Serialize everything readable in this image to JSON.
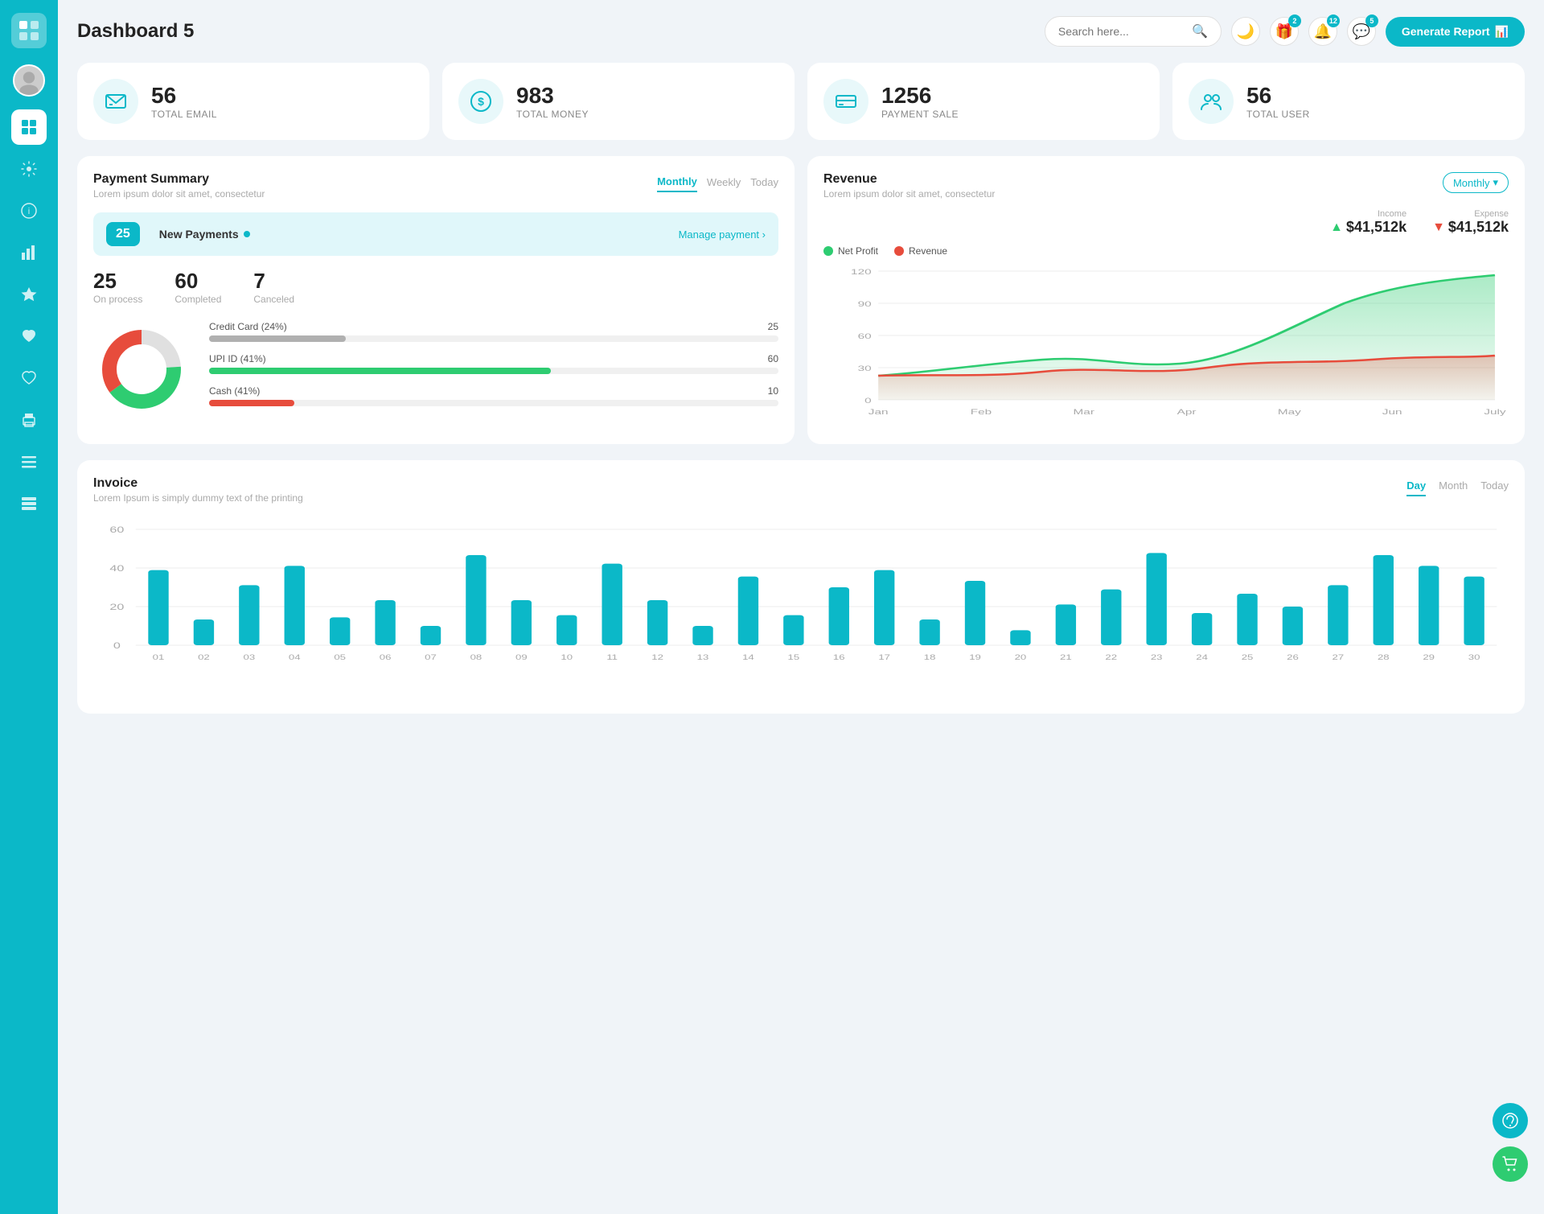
{
  "app": {
    "title": "Dashboard 5"
  },
  "header": {
    "search_placeholder": "Search here...",
    "generate_btn": "Generate Report",
    "badge_gifts": "2",
    "badge_bell": "12",
    "badge_chat": "5"
  },
  "stats": [
    {
      "id": "email",
      "number": "56",
      "label": "TOTAL EMAIL",
      "icon": "📋"
    },
    {
      "id": "money",
      "number": "983",
      "label": "TOTAL MONEY",
      "icon": "$"
    },
    {
      "id": "payment",
      "number": "1256",
      "label": "PAYMENT SALE",
      "icon": "💳"
    },
    {
      "id": "user",
      "number": "56",
      "label": "TOTAL USER",
      "icon": "👥"
    }
  ],
  "payment_summary": {
    "title": "Payment Summary",
    "subtitle": "Lorem ipsum dolor sit amet, consectetur",
    "tabs": [
      "Monthly",
      "Weekly",
      "Today"
    ],
    "active_tab": "Monthly",
    "new_payments_count": "25",
    "new_payments_label": "New Payments",
    "manage_payment": "Manage payment",
    "on_process": "25",
    "on_process_label": "On process",
    "completed": "60",
    "completed_label": "Completed",
    "canceled": "7",
    "canceled_label": "Canceled",
    "payment_methods": [
      {
        "label": "Credit Card (24%)",
        "percent": 24,
        "value": 25,
        "color": "#b0b0b0"
      },
      {
        "label": "UPI ID (41%)",
        "percent": 41,
        "value": 60,
        "color": "#2ecc71"
      },
      {
        "label": "Cash (41%)",
        "percent": 41,
        "value": 10,
        "color": "#e74c3c"
      }
    ]
  },
  "revenue": {
    "title": "Revenue",
    "subtitle": "Lorem ipsum dolor sit amet, consectetur",
    "monthly_label": "Monthly",
    "income_label": "Income",
    "income_amount": "$41,512k",
    "expense_label": "Expense",
    "expense_amount": "$41,512k",
    "legend": [
      {
        "label": "Net Profit",
        "color": "#2ecc71"
      },
      {
        "label": "Revenue",
        "color": "#e74c3c"
      }
    ],
    "x_labels": [
      "Jan",
      "Feb",
      "Mar",
      "Apr",
      "May",
      "Jun",
      "July"
    ],
    "y_labels": [
      "0",
      "30",
      "60",
      "90",
      "120"
    ]
  },
  "invoice": {
    "title": "Invoice",
    "subtitle": "Lorem Ipsum is simply dummy text of the printing",
    "tabs": [
      "Day",
      "Month",
      "Today"
    ],
    "active_tab": "Day",
    "y_labels": [
      "0",
      "20",
      "40",
      "60"
    ],
    "x_labels": [
      "01",
      "02",
      "03",
      "04",
      "05",
      "06",
      "07",
      "08",
      "09",
      "10",
      "11",
      "12",
      "13",
      "14",
      "15",
      "16",
      "17",
      "18",
      "19",
      "20",
      "21",
      "22",
      "23",
      "24",
      "25",
      "26",
      "27",
      "28",
      "29",
      "30"
    ],
    "bars": [
      35,
      12,
      28,
      37,
      13,
      21,
      9,
      42,
      21,
      14,
      38,
      21,
      9,
      32,
      14,
      27,
      35,
      12,
      30,
      7,
      19,
      26,
      43,
      15,
      24,
      18,
      28,
      42,
      37,
      32
    ]
  },
  "sidebar": {
    "items": [
      {
        "id": "dashboard",
        "icon": "grid",
        "active": true
      },
      {
        "id": "settings",
        "icon": "gear"
      },
      {
        "id": "info",
        "icon": "info"
      },
      {
        "id": "chart",
        "icon": "chart"
      },
      {
        "id": "star",
        "icon": "star"
      },
      {
        "id": "heart1",
        "icon": "heart"
      },
      {
        "id": "heart2",
        "icon": "heart2"
      },
      {
        "id": "printer",
        "icon": "printer"
      },
      {
        "id": "menu",
        "icon": "menu"
      },
      {
        "id": "list",
        "icon": "list"
      }
    ]
  }
}
